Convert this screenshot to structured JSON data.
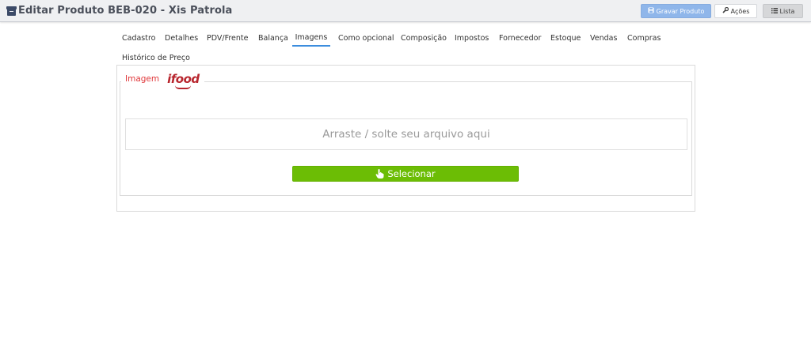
{
  "header": {
    "title": "Editar Produto BEB-020 - Xis Patrola",
    "title_icon": "archive-icon",
    "buttons": {
      "save": {
        "label": "Gravar Produto",
        "icon": "save-icon"
      },
      "actions": {
        "label": "Ações",
        "icon": "wrench-icon"
      },
      "list": {
        "label": "Lista",
        "icon": "list-icon"
      }
    }
  },
  "tabs": [
    {
      "label": "Cadastro"
    },
    {
      "label": "Detalhes"
    },
    {
      "label": "PDV/Frente"
    },
    {
      "label": "Balança"
    },
    {
      "label": "Imagens",
      "active": true
    },
    {
      "label": "Como opcional"
    },
    {
      "label": "Composição"
    },
    {
      "label": "Impostos"
    },
    {
      "label": "Fornecedor"
    },
    {
      "label": "Estoque"
    },
    {
      "label": "Vendas"
    },
    {
      "label": "Compras"
    },
    {
      "label": "Histórico de Preço"
    }
  ],
  "image_section": {
    "legend": "Imagem",
    "logo_text": "ifood",
    "dropzone_text": "Arraste / solte seu arquivo aqui",
    "select_button": {
      "label": "Selecionar",
      "icon": "hand-pointer-icon"
    }
  },
  "colors": {
    "accent": "#3c8dde",
    "save_button": "#8fb6ea",
    "select_button": "#6cbd05",
    "legend_red": "#e0373a",
    "ifood_red": "#b8262e"
  }
}
